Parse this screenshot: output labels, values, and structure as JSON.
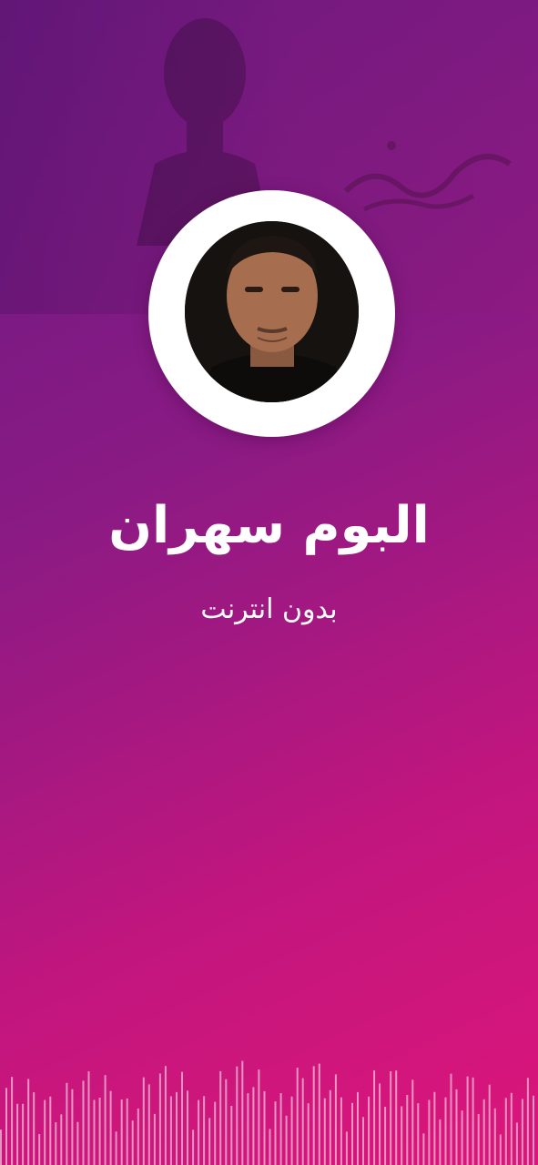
{
  "album": {
    "title": "البوم سهران",
    "subtitle": "بدون انترنت"
  },
  "icons": {
    "avatar": "artist-portrait",
    "banner": "album-cover-art",
    "decoration": "audio-waveform"
  },
  "colors": {
    "gradient_start": "#6a1a82",
    "gradient_end": "#dc157a",
    "text": "#ffffff",
    "ring": "#ffffff"
  }
}
